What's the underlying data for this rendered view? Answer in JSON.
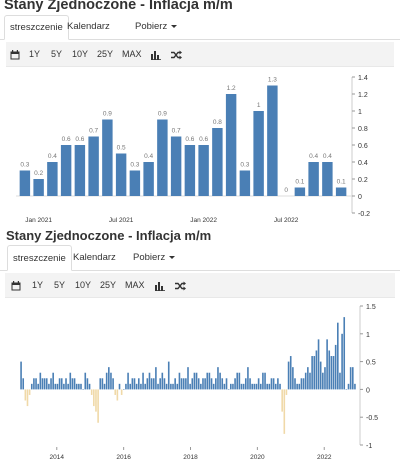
{
  "colors": {
    "bar": "#4a7fb5",
    "bar_negative": "#f0d9a8",
    "toolbar_bg": "#f3f3f3"
  },
  "panel1": {
    "title": "Stany Zjednoczone - Inflacja m/m",
    "tabs": [
      {
        "label": "streszczenie",
        "active": true
      },
      {
        "label": "Kalendarz"
      },
      {
        "label": "Pobierz"
      }
    ],
    "toolbar": {
      "calendar_icon": "calendar-icon",
      "ranges": [
        "1Y",
        "5Y",
        "10Y",
        "25Y",
        "MAX"
      ],
      "bar_chart_icon": "bar-chart-icon",
      "shuffle_icon": "shuffle-icon"
    }
  },
  "panel2": {
    "title": "Stany Zjednoczone - Inflacja m/m",
    "tabs": [
      {
        "label": "streszczenie",
        "active": true
      },
      {
        "label": "Kalendarz"
      },
      {
        "label": "Pobierz"
      }
    ],
    "toolbar": {
      "calendar_icon": "calendar-icon",
      "ranges": [
        "1Y",
        "5Y",
        "10Y",
        "25Y",
        "MAX"
      ],
      "bar_chart_icon": "bar-chart-icon",
      "shuffle_icon": "shuffle-icon"
    }
  },
  "chart_data": [
    {
      "type": "bar",
      "title": "Stany Zjednoczone - Inflacja m/m",
      "xlabel": "",
      "ylabel": "",
      "ylim": [
        -0.2,
        1.4
      ],
      "yticks": [
        1.4,
        1.2,
        1,
        0.8,
        0.6,
        0.4,
        0.2,
        0,
        -0.2
      ],
      "x_tick_labels": [
        "Jan 2021",
        "Jul 2021",
        "Jan 2022",
        "Jul 2022"
      ],
      "x_tick_indices": [
        1,
        7,
        13,
        19
      ],
      "categories": [
        "2020-12",
        "2021-01",
        "2021-02",
        "2021-03",
        "2021-04",
        "2021-05",
        "2021-06",
        "2021-07",
        "2021-08",
        "2021-09",
        "2021-10",
        "2021-11",
        "2021-12",
        "2022-01",
        "2022-02",
        "2022-03",
        "2022-04",
        "2022-05",
        "2022-06",
        "2022-07",
        "2022-08",
        "2022-09",
        "2022-10",
        "2022-11"
      ],
      "values": [
        0.3,
        0.2,
        0.4,
        0.6,
        0.6,
        0.7,
        0.9,
        0.5,
        0.3,
        0.4,
        0.9,
        0.7,
        0.6,
        0.6,
        0.8,
        1.2,
        0.3,
        1,
        1.3,
        0,
        0.1,
        0.4,
        0.4,
        0.1
      ],
      "data_labels": [
        "0.3",
        "0.2",
        "0.4",
        "0.6",
        "0.6",
        "0.7",
        "0.9",
        "0.5",
        "0.3",
        "0.4",
        "0.9",
        "0.7",
        "0.6",
        "0.6",
        "0.8",
        "1.2",
        "0.3",
        "1",
        "1.3",
        "0",
        "0.1",
        "0.4",
        "0.4",
        "0.1"
      ],
      "grid": false,
      "axis_side": "right"
    },
    {
      "type": "bar",
      "title": "Stany Zjednoczone - Inflacja m/m",
      "xlabel": "",
      "ylabel": "",
      "ylim": [
        -1,
        1.5
      ],
      "yticks": [
        1.5,
        1,
        0.5,
        0,
        -0.5,
        -1
      ],
      "x_tick_labels": [
        "2014",
        "2016",
        "2018",
        "2020",
        "2022"
      ],
      "x_tick_years": [
        2014,
        2016,
        2018,
        2020,
        2022
      ],
      "x_start": 2012.9,
      "x_end": 2022.95,
      "values": [
        0.5,
        0.2,
        -0.2,
        -0.3,
        -0.1,
        0.1,
        0.2,
        0.2,
        0.1,
        0.3,
        0.2,
        0.2,
        0.2,
        0.1,
        0.2,
        0.3,
        0.1,
        0.1,
        0.2,
        0.2,
        0.1,
        0.2,
        0.1,
        0.3,
        0.2,
        0.2,
        0.1,
        0.1,
        0.1,
        0.0,
        0.3,
        0.2,
        0.1,
        -0.1,
        -0.3,
        -0.4,
        -0.6,
        0.2,
        0.2,
        0.1,
        0.3,
        0.4,
        0.3,
        0.2,
        -0.1,
        -0.2,
        0.1,
        -0.1,
        0.0,
        0.1,
        0.3,
        0.1,
        0.2,
        0.2,
        0.1,
        0.2,
        0.1,
        0.3,
        0.1,
        0.2,
        0.3,
        0.2,
        0.2,
        0.4,
        0.1,
        0.2,
        0.3,
        0.2,
        0.1,
        0.5,
        0.1,
        0.1,
        0.2,
        0.1,
        0.3,
        0.2,
        0.2,
        0.2,
        0.4,
        0.1,
        0.2,
        0.3,
        0.3,
        0.2,
        0.1,
        0.2,
        0.2,
        0.3,
        0.3,
        0.2,
        0.1,
        0.2,
        0.4,
        0.3,
        0.2,
        0.1,
        0.2,
        0.0,
        0.1,
        0.1,
        0.2,
        0.3,
        0.3,
        0.1,
        0.1,
        0.2,
        0.4,
        0.2,
        0.1,
        0.1,
        0.1,
        0.2,
        0.1,
        0.3,
        0.3,
        0.1,
        0.1,
        0.2,
        0.2,
        0.1,
        0.2,
        0.1,
        -0.4,
        -0.8,
        -0.1,
        0.5,
        0.6,
        0.4,
        0.2,
        0.1,
        0.1,
        0.2,
        0.2,
        0.3,
        0.4,
        0.3,
        0.6,
        0.6,
        0.7,
        0.9,
        0.5,
        0.3,
        0.4,
        0.9,
        0.7,
        0.6,
        0.6,
        0.8,
        1.2,
        0.3,
        1.0,
        1.3,
        0.0,
        0.1,
        0.4,
        0.4,
        0.1
      ],
      "grid": false,
      "axis_side": "right"
    }
  ]
}
